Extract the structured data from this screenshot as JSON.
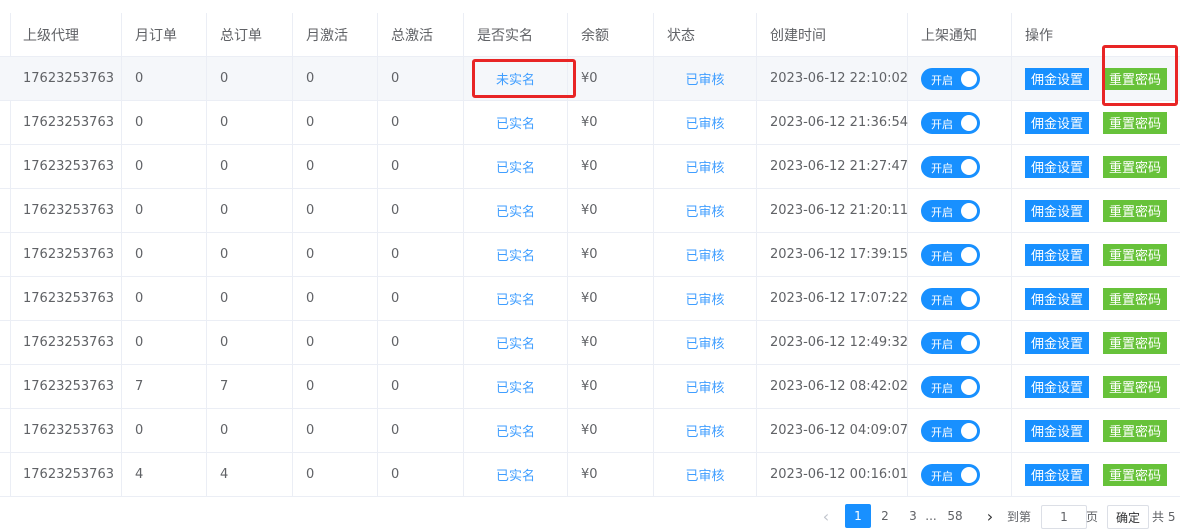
{
  "headers": {
    "agent": "上级代理",
    "monthly_orders": "月订单",
    "total_orders": "总订单",
    "monthly_activations": "月激活",
    "total_activations": "总激活",
    "verified": "是否实名",
    "balance": "余额",
    "status": "状态",
    "created_at": "创建时间",
    "listing_notice": "上架通知",
    "actions": "操作"
  },
  "toggle_label": "开启",
  "commission_button": "佣金设置",
  "reset_button": "重置密码",
  "rows": [
    {
      "agent": "17623253763",
      "monthly_orders": "0",
      "total_orders": "0",
      "monthly_activations": "0",
      "total_activations": "0",
      "verified": "未实名",
      "balance": "¥0",
      "status": "已审核",
      "created_at": "2023-06-12 22:10:02"
    },
    {
      "agent": "17623253763",
      "monthly_orders": "0",
      "total_orders": "0",
      "monthly_activations": "0",
      "total_activations": "0",
      "verified": "已实名",
      "balance": "¥0",
      "status": "已审核",
      "created_at": "2023-06-12 21:36:54"
    },
    {
      "agent": "17623253763",
      "monthly_orders": "0",
      "total_orders": "0",
      "monthly_activations": "0",
      "total_activations": "0",
      "verified": "已实名",
      "balance": "¥0",
      "status": "已审核",
      "created_at": "2023-06-12 21:27:47"
    },
    {
      "agent": "17623253763",
      "monthly_orders": "0",
      "total_orders": "0",
      "monthly_activations": "0",
      "total_activations": "0",
      "verified": "已实名",
      "balance": "¥0",
      "status": "已审核",
      "created_at": "2023-06-12 21:20:11"
    },
    {
      "agent": "17623253763",
      "monthly_orders": "0",
      "total_orders": "0",
      "monthly_activations": "0",
      "total_activations": "0",
      "verified": "已实名",
      "balance": "¥0",
      "status": "已审核",
      "created_at": "2023-06-12 17:39:15"
    },
    {
      "agent": "17623253763",
      "monthly_orders": "0",
      "total_orders": "0",
      "monthly_activations": "0",
      "total_activations": "0",
      "verified": "已实名",
      "balance": "¥0",
      "status": "已审核",
      "created_at": "2023-06-12 17:07:22"
    },
    {
      "agent": "17623253763",
      "monthly_orders": "0",
      "total_orders": "0",
      "monthly_activations": "0",
      "total_activations": "0",
      "verified": "已实名",
      "balance": "¥0",
      "status": "已审核",
      "created_at": "2023-06-12 12:49:32"
    },
    {
      "agent": "17623253763",
      "monthly_orders": "7",
      "total_orders": "7",
      "monthly_activations": "0",
      "total_activations": "0",
      "verified": "已实名",
      "balance": "¥0",
      "status": "已审核",
      "created_at": "2023-06-12 08:42:02"
    },
    {
      "agent": "17623253763",
      "monthly_orders": "0",
      "total_orders": "0",
      "monthly_activations": "0",
      "total_activations": "0",
      "verified": "已实名",
      "balance": "¥0",
      "status": "已审核",
      "created_at": "2023-06-12 04:09:07"
    },
    {
      "agent": "17623253763",
      "monthly_orders": "4",
      "total_orders": "4",
      "monthly_activations": "0",
      "total_activations": "0",
      "verified": "已实名",
      "balance": "¥0",
      "status": "已审核",
      "created_at": "2023-06-12 00:16:01"
    }
  ],
  "pagination": {
    "prev_icon": "chevron-left-icon",
    "pages": [
      "1",
      "2",
      "3"
    ],
    "ellipsis": "...",
    "last_page": "58",
    "next_icon": "chevron-right-icon",
    "goto_label": "到第",
    "goto_value": "1",
    "page_unit": "页",
    "confirm": "确定",
    "total_partial": "共 5"
  },
  "colors": {
    "link_blue": "#409eff",
    "primary_blue": "#1890ff",
    "success_green": "#67c23a",
    "highlight_red": "#e82525"
  }
}
